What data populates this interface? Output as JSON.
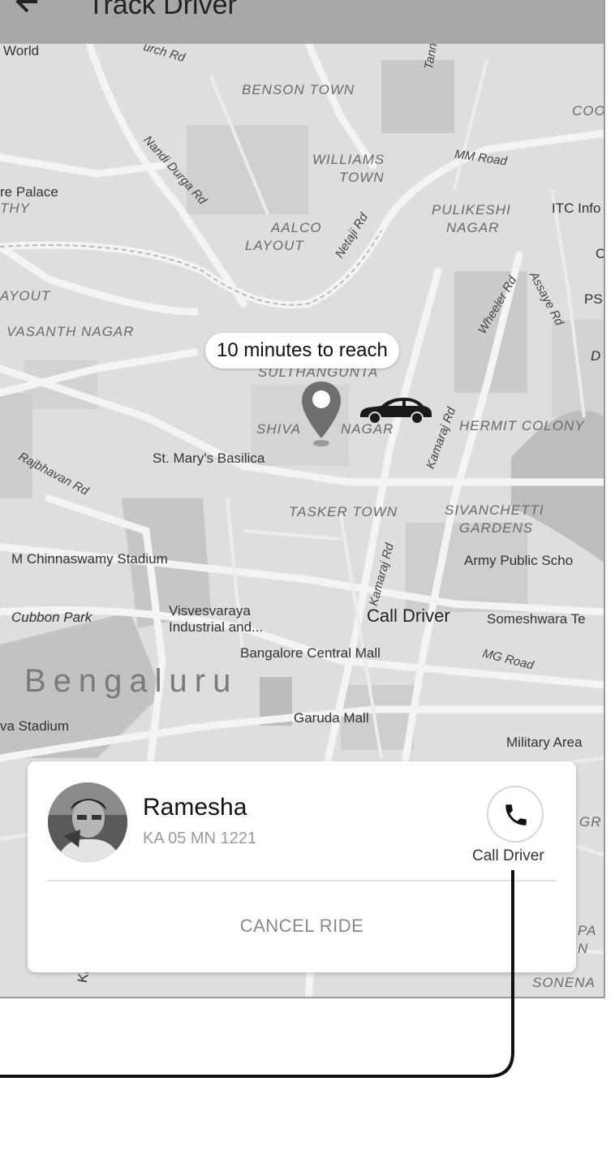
{
  "header": {
    "title": "Track Driver"
  },
  "map": {
    "eta_label": "10 minutes to reach",
    "city_label": "Bengaluru",
    "call_driver_label": "Call Driver",
    "area_labels": {
      "benson_town": "BENSON TOWN",
      "williams_town_1": "WILLIAMS",
      "williams_town_2": "TOWN",
      "aalco_1": "AALCO",
      "aalco_2": "LAYOUT",
      "pulikeshi_1": "PULIKESHI",
      "pulikeshi_2": "NAGAR",
      "layout": "AYOUT",
      "thy": "THY",
      "vasanth": "VASANTH NAGAR",
      "sulthangunta": "SULTHANGUNTA",
      "shivaji": "SHIVA",
      "shivaji_2": "NAGAR",
      "hermit": "HERMIT COLONY",
      "tasker": "TASKER TOWN",
      "sivanchetti_1": "SIVANCHETTI",
      "sivanchetti_2": "GARDENS",
      "sonena": "SONENA",
      "coo": "COO",
      "gr": "GR",
      "pa": "PA",
      "n": "N"
    },
    "road_labels": {
      "church": "urch Rd",
      "nandi": "Nandi Durga Rd",
      "tannery": "Tannery",
      "netaji": "Netaji Rd",
      "mm": "MM Road",
      "wheeler": "Wheeler Rd",
      "assaye": "Assaye Rd",
      "kamaraj_1": "Kamaraj Rd",
      "kamaraj_2": "Kamaraj Rd",
      "rajbhavan": "Rajbhavan Rd",
      "mg": "MG Road"
    },
    "poi_labels": {
      "world": "World",
      "palace": "re Palace",
      "itc": "ITC Info",
      "ps": "PS",
      "d": "D",
      "c": "C",
      "basilica": "St. Mary's Basilica",
      "stadium": "M Chinnaswamy Stadium",
      "army": "Army Public Scho",
      "cubbon": "Cubbon Park",
      "visves_1": "Visvesvaraya",
      "visves_2": "Industrial and...",
      "someshwara": "Someshwara Te",
      "central_mall": "Bangalore Central Mall",
      "garuda": "Garuda Mall",
      "military": "Military Area",
      "va_stadium": "va Stadium",
      "kh": "KH"
    }
  },
  "driver": {
    "name": "Ramesha",
    "plate": "KA 05 MN 1221",
    "call_label": "Call Driver"
  },
  "actions": {
    "cancel_label": "CANCEL RIDE"
  },
  "colors": {
    "appbar": "#a8a8a8",
    "map_bg": "#dedede",
    "pin": "#6e6e6e",
    "car": "#1a1a1a"
  }
}
